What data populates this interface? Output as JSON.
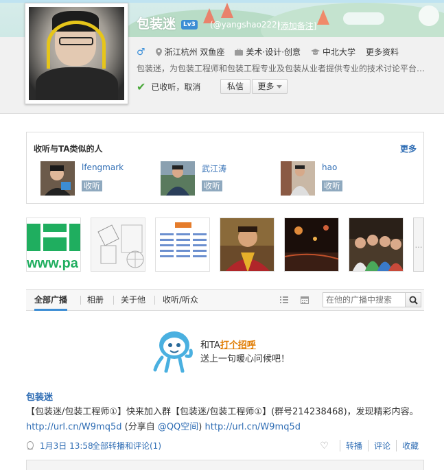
{
  "profile": {
    "name": "包装迷",
    "level": "Lv3",
    "handle": "(@yangshao222)",
    "remark_link": "添加备注",
    "gender_symbol": "♂",
    "location": "浙江杭州 双鱼座",
    "industry": "美术·设计·创意",
    "school": "中北大学",
    "more_info": "更多资料",
    "bio": "包装迷，为包装工程师和包装工程专业及包装从业者提供专业的技术讨论平台…",
    "follow_state": "已收听，取消",
    "message_button": "私信",
    "more_button": "更多"
  },
  "similar": {
    "title": "收听与TA类似的人",
    "more": "更多",
    "people": [
      {
        "name": "lfengmark",
        "follow": "收听"
      },
      {
        "name": "武江涛",
        "follow": "收听"
      },
      {
        "name": "hao",
        "follow": "收听"
      }
    ]
  },
  "photos": [
    "logo-photo",
    "sketch-photo",
    "diagram-photo",
    "monk-photo",
    "night-photo",
    "group-photo"
  ],
  "tabs": {
    "all": "全部广播",
    "album": "相册",
    "about": "关于他",
    "followers": "收听/听众",
    "search_placeholder": "在他的广播中搜索"
  },
  "greeting": {
    "line1_prefix": "和TA",
    "line1_link": "打个招呼",
    "line2": "送上一句暖心问候吧！"
  },
  "post": {
    "author": "包装迷",
    "text_part1": "【包装迷/包装工程师①】快来加入群【包装迷/包装工程师①】(群号214238468)，发现精彩内容。",
    "link1": "http://url.cn/W9mq5d",
    "text_part2": " (分享自 ",
    "link2": "@QQ空间",
    "text_part3": ") ",
    "link3": "http://url.cn/W9mq5d",
    "time": "1月3日 13:58",
    "relay": "全部转播和评论(1)",
    "action_relay": "转播",
    "action_comment": "评论",
    "action_fav": "收藏"
  },
  "colors": {
    "link": "#2f6db4",
    "accent": "#3c8dd4",
    "follow_btn": "#8fa9bf",
    "highlight": "#e07b00"
  }
}
